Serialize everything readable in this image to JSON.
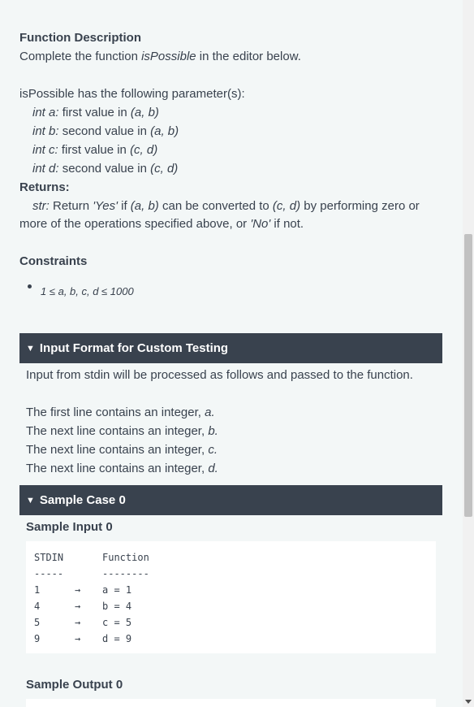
{
  "function_description": {
    "heading": "Function Description",
    "intro_prefix": "Complete the function ",
    "function_name": "isPossible",
    "intro_suffix": " in the editor below.",
    "params_intro": "isPossible has the following parameter(s):",
    "params": [
      {
        "name": "int a:",
        "desc": " first value in ",
        "range": "(a, b)"
      },
      {
        "name": "int b:",
        "desc": " second value in ",
        "range": "(a, b)"
      },
      {
        "name": "int c:",
        "desc": " first value in ",
        "range": "(c, d)"
      },
      {
        "name": "int d:",
        "desc": " second value in ",
        "range": "(c, d)"
      }
    ],
    "returns_heading": "Returns:",
    "returns_type": "str:",
    "returns_t1": " Return ",
    "returns_yes": "'Yes'",
    "returns_t2": " if ",
    "returns_ab": "(a, b)",
    "returns_t3": " can be converted to ",
    "returns_cd": "(c, d)",
    "returns_t4": " by performing zero or",
    "returns_line2_a": "more of the operations specified above, or ",
    "returns_no": "'No'",
    "returns_line2_b": " if not."
  },
  "constraints": {
    "heading": "Constraints",
    "item": "1 ≤ a, b, c, d ≤ 1000"
  },
  "input_format": {
    "title": "Input Format for Custom Testing",
    "intro": "Input from stdin will be processed as follows and passed to the function.",
    "lines": [
      {
        "text": "The first line contains an integer, ",
        "var": "a."
      },
      {
        "text": "The next line contains an integer, ",
        "var": "b."
      },
      {
        "text": "The next line contains an integer, ",
        "var": "c."
      },
      {
        "text": "The next line contains an integer, ",
        "var": "d."
      }
    ]
  },
  "sample_case": {
    "title": "Sample Case 0",
    "input_heading": "Sample Input 0",
    "col_stdin": "STDIN",
    "col_function": "Function",
    "sep_stdin": "-----",
    "sep_function": "--------",
    "arrow": "→",
    "rows": [
      {
        "stdin": "1",
        "func": "a = 1"
      },
      {
        "stdin": "4",
        "func": "b = 4"
      },
      {
        "stdin": "5",
        "func": "c = 5"
      },
      {
        "stdin": "9",
        "func": "d = 9"
      }
    ],
    "output_heading": "Sample Output 0"
  }
}
